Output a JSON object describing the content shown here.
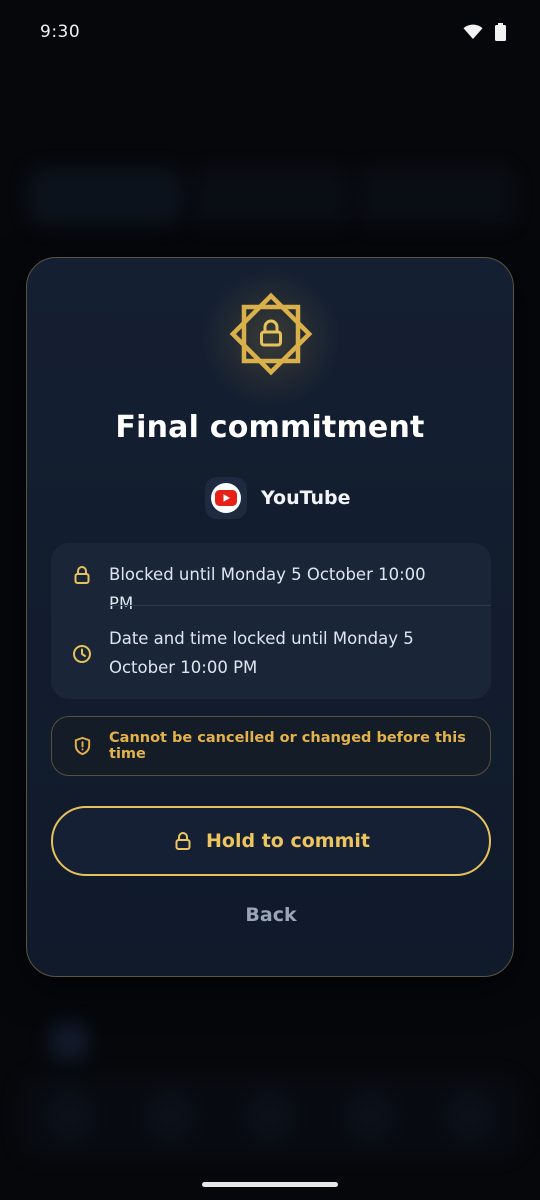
{
  "status_bar": {
    "time": "9:30"
  },
  "modal": {
    "title": "Final commitment",
    "app": {
      "name": "YouTube"
    },
    "info": [
      {
        "icon": "lock-icon",
        "text": "Blocked until Monday 5 October 10:00 PM"
      },
      {
        "icon": "clock-icon",
        "text": "Date and time locked until Monday 5 October 10:00 PM"
      }
    ],
    "warning": {
      "icon": "shield-alert-icon",
      "text": "Cannot be cancelled or changed before this time"
    },
    "commit_button": {
      "label": "Hold to commit"
    },
    "back_button": {
      "label": "Back"
    }
  },
  "colors": {
    "accent_gold": "#e6c25c",
    "warning_text": "#e3b24a",
    "youtube_red": "#e62117",
    "modal_bg": "#121d2e"
  }
}
